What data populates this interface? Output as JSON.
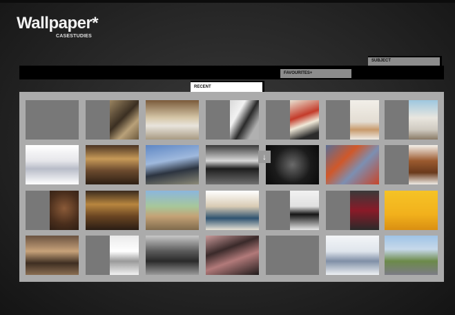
{
  "brand": {
    "logo_main": "Wallpaper*",
    "logo_sub": "CASESTUDIES"
  },
  "tabs": {
    "subject": "SUBJECT",
    "favourites": "FAVOURITES+",
    "recent": "RECENT"
  },
  "grid": {
    "tiles": [
      {
        "label": "",
        "icon": "blank-tile"
      },
      {
        "label": "",
        "icon": "interior-photo"
      },
      {
        "label": "",
        "icon": "lobby-photo"
      },
      {
        "label": "",
        "icon": "fashion-photo"
      },
      {
        "label": "",
        "icon": "geometric-art-photo"
      },
      {
        "label": "",
        "icon": "product-photo"
      },
      {
        "label": "",
        "icon": "retail-interior-photo"
      },
      {
        "label": "",
        "icon": "glass-chess-photo"
      },
      {
        "label": "",
        "icon": "restaurant-photo"
      },
      {
        "label": "",
        "icon": "building-photo"
      },
      {
        "label": "",
        "icon": "kitchen-photo"
      },
      {
        "label": "",
        "icon": "watch-photo"
      },
      {
        "label": "",
        "icon": "shop-window-photo"
      },
      {
        "label": "",
        "icon": "shoes-photo"
      },
      {
        "label": "",
        "icon": "objects-photo"
      },
      {
        "label": "",
        "icon": "lounge-photo"
      },
      {
        "label": "",
        "icon": "house-photo"
      },
      {
        "label": "",
        "icon": "dining-room-photo"
      },
      {
        "label": "",
        "icon": "handbag-photo"
      },
      {
        "label": "",
        "icon": "tie-photo"
      },
      {
        "label": "",
        "icon": "yellow-still-life-photo"
      },
      {
        "label": "",
        "icon": "bedroom-photo"
      },
      {
        "label": "",
        "icon": "camera-photo"
      },
      {
        "label": "",
        "icon": "industrial-interior-photo"
      },
      {
        "label": "",
        "icon": "tunnel-photo"
      },
      {
        "label": "",
        "icon": "down-arrow-icon"
      },
      {
        "label": "",
        "icon": "gallery-photo"
      },
      {
        "label": "",
        "icon": "river-city-photo"
      }
    ],
    "down_arrow": "↓"
  }
}
